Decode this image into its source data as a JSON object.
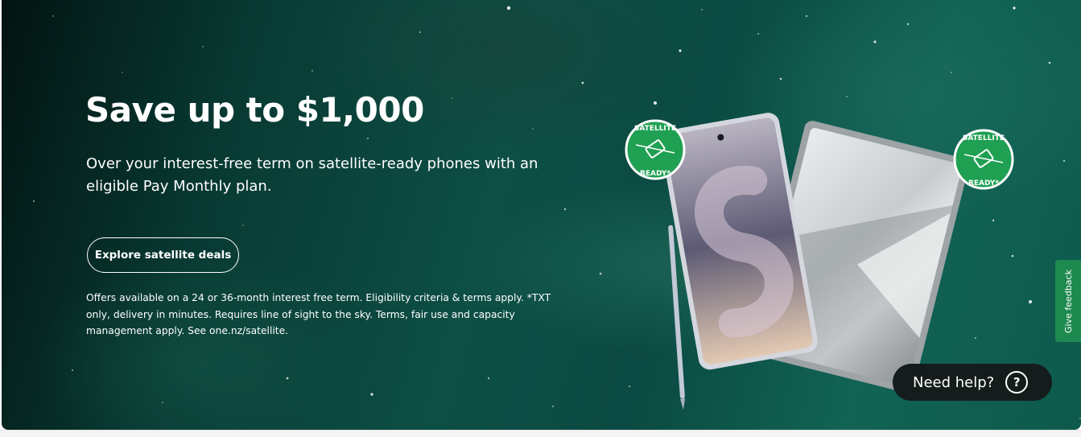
{
  "hero": {
    "title": "Save up to $1,000",
    "subtitle": "Over your interest-free term on satellite-ready phones with an eligible Pay Monthly plan.",
    "cta_label": "Explore satellite deals",
    "terms": "Offers available on a 24 or 36-month interest free term. Eligibility criteria & terms apply. *TXT only, delivery in minutes. Requires line of sight to the sky. Terms, fair use and capacity management apply. See one.nz/satellite."
  },
  "badges": {
    "text": "SATELLITE READY*",
    "color": "#1fa052"
  },
  "widgets": {
    "help_label": "Need help?",
    "help_icon": "?",
    "feedback_label": "Give feedback"
  },
  "colors": {
    "background": "#0b4a42",
    "help_bg": "#151c1c",
    "feedback_bg": "#1f8a4f"
  }
}
